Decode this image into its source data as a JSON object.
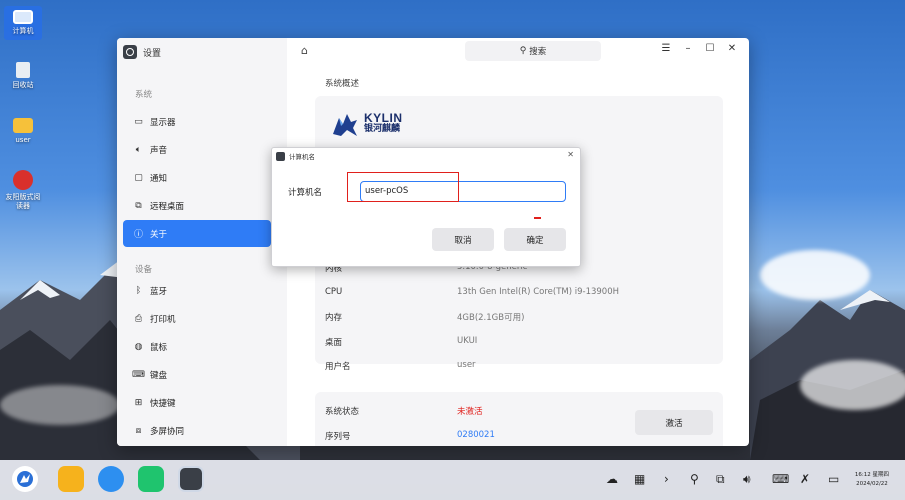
{
  "desktop": {
    "icons": [
      {
        "label": "计算机",
        "icon": "computer-icon"
      },
      {
        "label": "回收站",
        "icon": "trash-icon"
      },
      {
        "label": "user",
        "icon": "folder-icon"
      },
      {
        "label": "友阳版式阅读器",
        "icon": "reader-icon"
      }
    ]
  },
  "window": {
    "title": "设置",
    "search_placeholder": "搜索",
    "sidebar": {
      "group_system": "系统",
      "system_items": [
        {
          "label": "显示器",
          "icon": "display-icon"
        },
        {
          "label": "声音",
          "icon": "sound-icon"
        },
        {
          "label": "通知",
          "icon": "notification-icon"
        },
        {
          "label": "远程桌面",
          "icon": "remote-desktop-icon"
        },
        {
          "label": "关于",
          "icon": "info-icon",
          "active": true
        }
      ],
      "group_devices": "设备",
      "device_items": [
        {
          "label": "蓝牙",
          "icon": "bluetooth-icon"
        },
        {
          "label": "打印机",
          "icon": "printer-icon"
        },
        {
          "label": "鼠标",
          "icon": "mouse-icon"
        },
        {
          "label": "键盘",
          "icon": "keyboard-icon"
        },
        {
          "label": "快捷键",
          "icon": "shortcut-icon"
        },
        {
          "label": "多屏协同",
          "icon": "multiscreen-icon"
        }
      ]
    },
    "main": {
      "section_title": "系统概述",
      "logo_text": "KYLIN",
      "logo_subtext": "银河麒麟",
      "info": [
        {
          "key": "内核",
          "value": "5.10.0-8-generic"
        },
        {
          "key": "CPU",
          "value": "13th Gen Intel(R) Core(TM) i9-13900H"
        },
        {
          "key": "内存",
          "value": "4GB(2.1GB可用)"
        },
        {
          "key": "桌面",
          "value": "UKUI"
        },
        {
          "key": "用户名",
          "value": "user"
        }
      ],
      "status": {
        "state_key": "系统状态",
        "state_value": "未激活",
        "serial_key": "序列号",
        "serial_value": "0280021",
        "activate_label": "激活"
      }
    }
  },
  "dialog": {
    "title": "计算机名",
    "field_label": "计算机名",
    "field_value": "user-pcOS",
    "cancel_label": "取消",
    "confirm_label": "确定"
  },
  "taskbar": {
    "time": "16:12 星期四",
    "date": "2024/02/22"
  },
  "colors": {
    "accent": "#2f7cf6",
    "error": "#e0201c",
    "annotation_box": "#e0201c"
  }
}
